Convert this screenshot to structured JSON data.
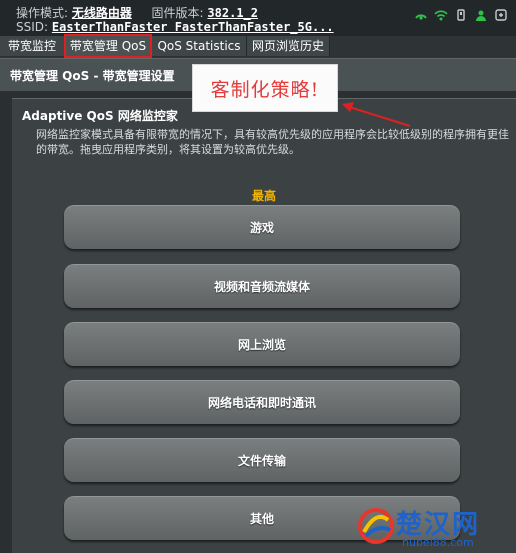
{
  "header": {
    "mode_label": "操作模式:",
    "mode_value": "无线路由器",
    "firmware_label": "固件版本:",
    "firmware_value": "382.1_2",
    "ssid_label": "SSID:",
    "ssid_value": "EasterThanFaster  FasterThanFaster_5G..."
  },
  "tabs": [
    {
      "label": "带宽监控"
    },
    {
      "label": "带宽管理 QoS"
    },
    {
      "label": "QoS Statistics"
    },
    {
      "label": "网页浏览历史"
    }
  ],
  "section": {
    "title": "带宽管理 QoS - 带宽管理设置"
  },
  "annotation": {
    "text": "客制化策略!"
  },
  "panel": {
    "title": "Adaptive QoS 网络监控家",
    "description": "网络监控家模式具备有限带宽的情况下，具有较高优先级的应用程序会比较低级别的程序拥有更佳的带宽。拖曳应用程序类别，将其设置为较高优先级。",
    "highest_label": "最高",
    "priority_items": [
      {
        "label": "游戏"
      },
      {
        "label": "视频和音频流媒体"
      },
      {
        "label": "网上浏览"
      },
      {
        "label": "网络电话和即时通讯"
      },
      {
        "label": "文件传输"
      },
      {
        "label": "其他"
      }
    ]
  },
  "watermark": {
    "text": "楚汉网",
    "url": "hubei88.com"
  },
  "colors": {
    "accent_highest": "#f2b400",
    "annotation_red": "#e02020",
    "status_green": "#2fc24a"
  },
  "icons": [
    "network-status-icon",
    "wifi-icon",
    "usb-icon",
    "user-icon",
    "app-icon"
  ]
}
